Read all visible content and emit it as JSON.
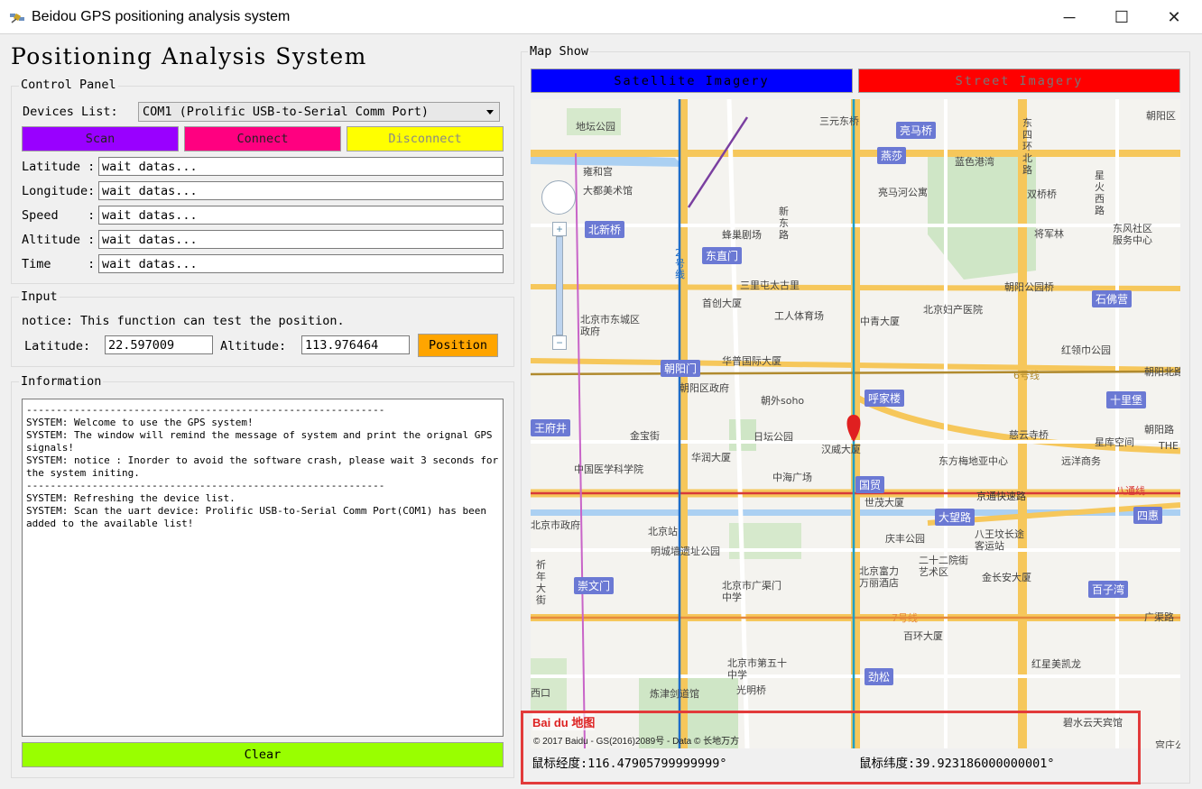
{
  "window": {
    "title": "Beidou GPS positioning analysis system",
    "minimize": "─",
    "maximize": "☐",
    "close": "✕"
  },
  "app_title": "Positioning Analysis System",
  "control_panel": {
    "label": "Control Panel",
    "devices_label": "Devices List:",
    "device_selected": "COM1 (Prolific USB-to-Serial Comm Port)",
    "scan": "Scan",
    "connect": "Connect",
    "disconnect": "Disconnect",
    "fields": [
      {
        "label": "Latitude :",
        "value": "wait datas..."
      },
      {
        "label": "Longitude:",
        "value": "wait datas..."
      },
      {
        "label": "Speed    :",
        "value": "wait datas..."
      },
      {
        "label": "Altitude :",
        "value": "wait datas..."
      },
      {
        "label": "Time     :",
        "value": "wait datas..."
      }
    ]
  },
  "input": {
    "label": "Input",
    "notice": "notice: This function can test the position.",
    "lat_label": "Latitude:",
    "lat_value": "22.597009",
    "alt_label": "Altitude:",
    "alt_value": "113.976464",
    "position_button": "Position"
  },
  "information": {
    "label": "Information",
    "log": "------------------------------------------------------------\nSYSTEM: Welcome to use the GPS system!\nSYSTEM: The window will remind the message of system and print the orignal GPS signals!\nSYSTEM: notice : Inorder to avoid the software crash, please wait 3 seconds for the system initing.\n------------------------------------------------------------\nSYSTEM: Refreshing the device list.\nSYSTEM: Scan the uart device: Prolific USB-to-Serial Comm Port(COM1) has been added to the available list!",
    "clear": "Clear"
  },
  "map_show": {
    "label": "Map Show",
    "satellite": "Satellite Imagery",
    "street": "Street Imagery",
    "copyright": "© 2017 Baidu - GS(2016)2089号 - Data © 长地万方",
    "logo": "Bai du 地图",
    "mouse_lng": "鼠标经度:116.47905799999999°",
    "mouse_lat": "鼠标纬度:39.923186000000001°",
    "places": {
      "p1": "地坛公园",
      "p2": "三元东桥",
      "p3": "亮马桥",
      "p4": "朝阳区",
      "p5": "雍和宫",
      "p6": "蓝色港湾",
      "p7": "燕莎",
      "p8": "东四环北路",
      "p9": "大都美术馆",
      "p10": "亮马河公寓",
      "p11": "双桥桥",
      "p12": "星火西路",
      "p13": "北新桥",
      "p14": "蜂巢剧场",
      "p15": "新东路",
      "p16": "将军林",
      "p17": "东风社区服务中心",
      "p18": "东直门",
      "p19": "三里屯太古里",
      "p20": "朝阳公园桥",
      "p21": "首创大厦",
      "p22": "工人体育场",
      "p23": "北京妇产医院",
      "p24": "石佛营",
      "p25": "北京市东城区政府",
      "p26": "中青大厦",
      "p27": "红领巾公园",
      "p28": "朝阳门",
      "p29": "华普国际大厦",
      "p30": "6号线",
      "p31": "朝阳北路",
      "p32": "朝阳区政府",
      "p33": "朝外soho",
      "p34": "呼家楼",
      "p35": "十里堡",
      "p36": "王府井",
      "p37": "金宝街",
      "p38": "日坛公园",
      "p39": "汉威大厦",
      "p40": "慈云寺桥",
      "p41": "星库空间",
      "p42": "朝阳路",
      "p43": "华润大厦",
      "p44": "中国医学科学院",
      "p45": "中海广场",
      "p46": "东方梅地亚中心",
      "p47": "远洋商务",
      "p48": "国贸",
      "p49": "世茂大厦",
      "p50": "京通快速路",
      "p51": "八通线",
      "p52": "北京市政府",
      "p53": "北京站",
      "p54": "大望路",
      "p55": "四惠",
      "p56": "明城墙遗址公园",
      "p57": "庆丰公园",
      "p58": "八王坟长途客运站",
      "p59": "北京富力万丽酒店",
      "p60": "二十二院街艺术区",
      "p61": "金长安大厦",
      "p62": "崇文门",
      "p63": "北京市广渠门中学",
      "p64": "百子湾",
      "p65": "祈年大街",
      "p66": "7号线",
      "p67": "广渠路",
      "p68": "百环大厦",
      "p69": "北京市第五十中学",
      "p70": "劲松",
      "p71": "红星美凯龙",
      "p72": "光明桥",
      "p73": "炼津剑道馆",
      "p74": "碧水云天宾馆",
      "p75": "宫庄公",
      "p76": "2号线",
      "p77": "THE",
      "p78": "西口",
      "p79": "京市政府",
      "p80": "北京市东城区政府"
    }
  },
  "colors": {
    "scan": "#9900ff",
    "connect": "#ff0080",
    "disconnect": "#ffff00",
    "position": "#ffa500",
    "clear": "#99ff00",
    "satellite": "#0000ff",
    "street": "#ff0000"
  }
}
